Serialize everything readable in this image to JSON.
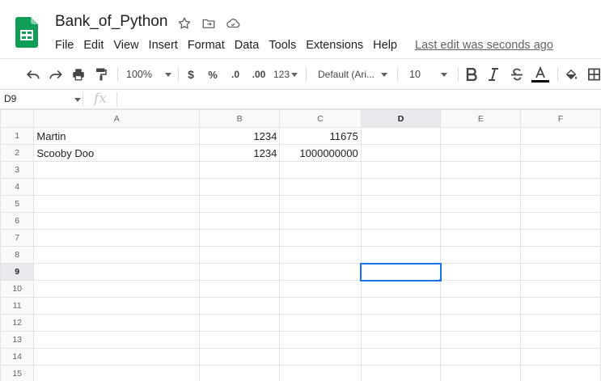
{
  "doc": {
    "title": "Bank_of_Python"
  },
  "menu": [
    "File",
    "Edit",
    "View",
    "Insert",
    "Format",
    "Data",
    "Tools",
    "Extensions",
    "Help"
  ],
  "last_edit": "Last edit was seconds ago",
  "toolbar": {
    "zoom": "100%",
    "currency": "$",
    "percent": "%",
    "decrease_decimal": ".0",
    "increase_decimal": ".00",
    "more_formats": "123",
    "font": "Default (Ari...",
    "font_size": "10"
  },
  "formula_bar": {
    "name_box": "D9",
    "fx": "fx",
    "value": ""
  },
  "grid": {
    "columns": [
      "A",
      "B",
      "C",
      "D",
      "E",
      "F"
    ],
    "rows": [
      {
        "num": "1",
        "cells": [
          "Martin",
          "1234",
          "11675",
          "",
          "",
          ""
        ]
      },
      {
        "num": "2",
        "cells": [
          "Scooby Doo",
          "1234",
          "1000000000",
          "",
          "",
          ""
        ]
      },
      {
        "num": "3",
        "cells": [
          "",
          "",
          "",
          "",
          "",
          ""
        ]
      },
      {
        "num": "4",
        "cells": [
          "",
          "",
          "",
          "",
          "",
          ""
        ]
      },
      {
        "num": "5",
        "cells": [
          "",
          "",
          "",
          "",
          "",
          ""
        ]
      },
      {
        "num": "6",
        "cells": [
          "",
          "",
          "",
          "",
          "",
          ""
        ]
      },
      {
        "num": "7",
        "cells": [
          "",
          "",
          "",
          "",
          "",
          ""
        ]
      },
      {
        "num": "8",
        "cells": [
          "",
          "",
          "",
          "",
          "",
          ""
        ]
      },
      {
        "num": "9",
        "cells": [
          "",
          "",
          "",
          "",
          "",
          ""
        ]
      },
      {
        "num": "10",
        "cells": [
          "",
          "",
          "",
          "",
          "",
          ""
        ]
      },
      {
        "num": "11",
        "cells": [
          "",
          "",
          "",
          "",
          "",
          ""
        ]
      },
      {
        "num": "12",
        "cells": [
          "",
          "",
          "",
          "",
          "",
          ""
        ]
      },
      {
        "num": "13",
        "cells": [
          "",
          "",
          "",
          "",
          "",
          ""
        ]
      },
      {
        "num": "14",
        "cells": [
          "",
          "",
          "",
          "",
          "",
          ""
        ]
      },
      {
        "num": "15",
        "cells": [
          "",
          "",
          "",
          "",
          "",
          ""
        ]
      }
    ],
    "selected_cell": "D9"
  },
  "colors": {
    "accent": "#1a73e8",
    "sheets_green": "#0f9d58"
  }
}
